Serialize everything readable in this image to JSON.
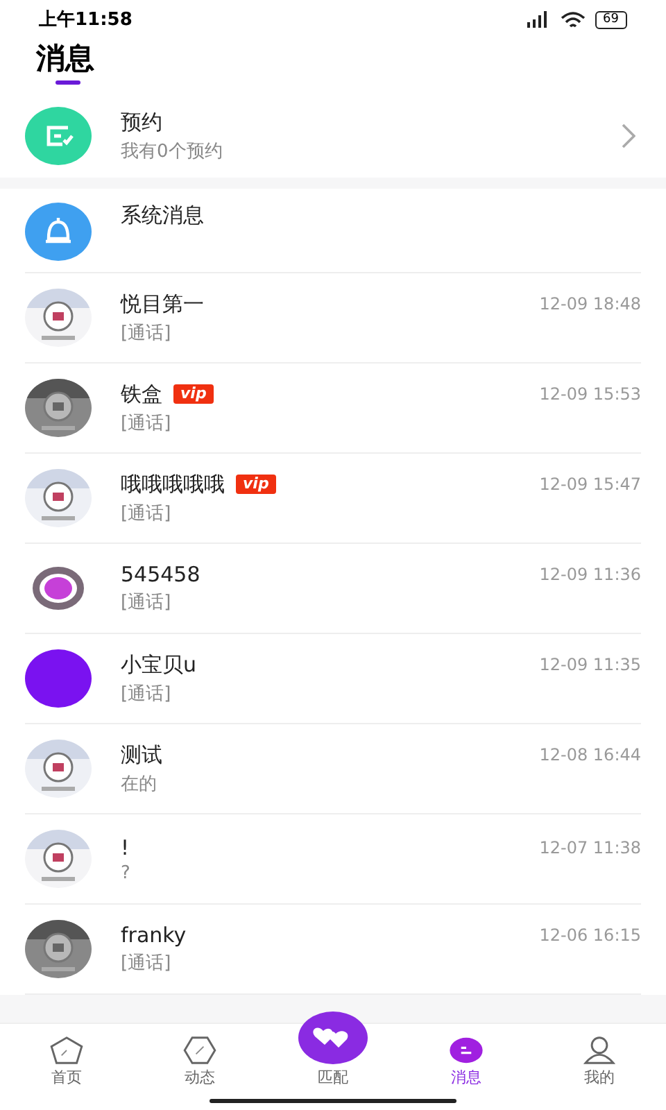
{
  "status_bar": {
    "time": "上午11:58",
    "battery": "69"
  },
  "header": {
    "title": "消息"
  },
  "appointment": {
    "title": "预约",
    "subtitle": "我有0个预约"
  },
  "system": {
    "title": "系统消息"
  },
  "conversations": [
    {
      "name": "悦目第一",
      "time": "12-09 18:48",
      "preview": "[通话]"
    },
    {
      "name": "铁盒",
      "badge": "vip",
      "time": "12-09 15:53",
      "preview": "[通话]"
    },
    {
      "name": "哦哦哦哦哦",
      "badge": "vip",
      "time": "12-09 15:47",
      "preview": "[通话]"
    },
    {
      "name": "545458",
      "time": "12-09 11:36",
      "preview": "[通话]",
      "avatar": {
        "kind": "ring"
      }
    },
    {
      "name": "小宝贝u",
      "time": "12-09 11:35",
      "preview": "[通话]",
      "avatar": {
        "kind": "solid"
      }
    },
    {
      "name": "测试",
      "time": "12-08 16:44",
      "preview": "在的"
    },
    {
      "name": "!",
      "time": "12-07 11:38",
      "preview": "?"
    },
    {
      "name": "franky",
      "time": "12-06 16:15",
      "preview": "[通话]"
    }
  ],
  "tabs": [
    {
      "label": "首页",
      "kind": "home",
      "selected": false
    },
    {
      "label": "动态",
      "kind": "feed",
      "selected": false
    },
    {
      "label": "匹配",
      "kind": "match",
      "selected": false
    },
    {
      "label": "消息",
      "kind": "messages",
      "selected": true
    },
    {
      "label": "我的",
      "kind": "profile",
      "selected": false
    }
  ]
}
